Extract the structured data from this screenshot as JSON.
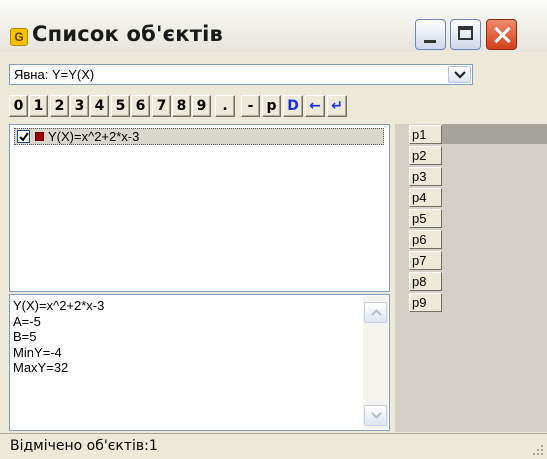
{
  "window": {
    "title": "Список об'єктів",
    "icon": "g-app-icon"
  },
  "function_type": {
    "selected": "Явна: Y=Y(X)"
  },
  "toolbar": {
    "buttons": [
      "0",
      "1",
      "2",
      "3",
      "4",
      "5",
      "6",
      "7",
      "8",
      "9",
      ".",
      "-",
      "p",
      "D",
      "←",
      "↵"
    ]
  },
  "objects": {
    "items": [
      {
        "label": "Y(X)=x^2+2*x-3",
        "checked": true,
        "color": "#a00000"
      }
    ]
  },
  "info": {
    "lines": [
      "Y(X)=x^2+2*x-3",
      "A=-5",
      "B=5",
      "MinY=-4",
      "MaxY=32"
    ]
  },
  "params": {
    "labels": [
      "p1",
      "p2",
      "p3",
      "p4",
      "p5",
      "p6",
      "p7",
      "p8",
      "p9"
    ]
  },
  "status": {
    "text": "Відмічено об'єктів:1"
  }
}
